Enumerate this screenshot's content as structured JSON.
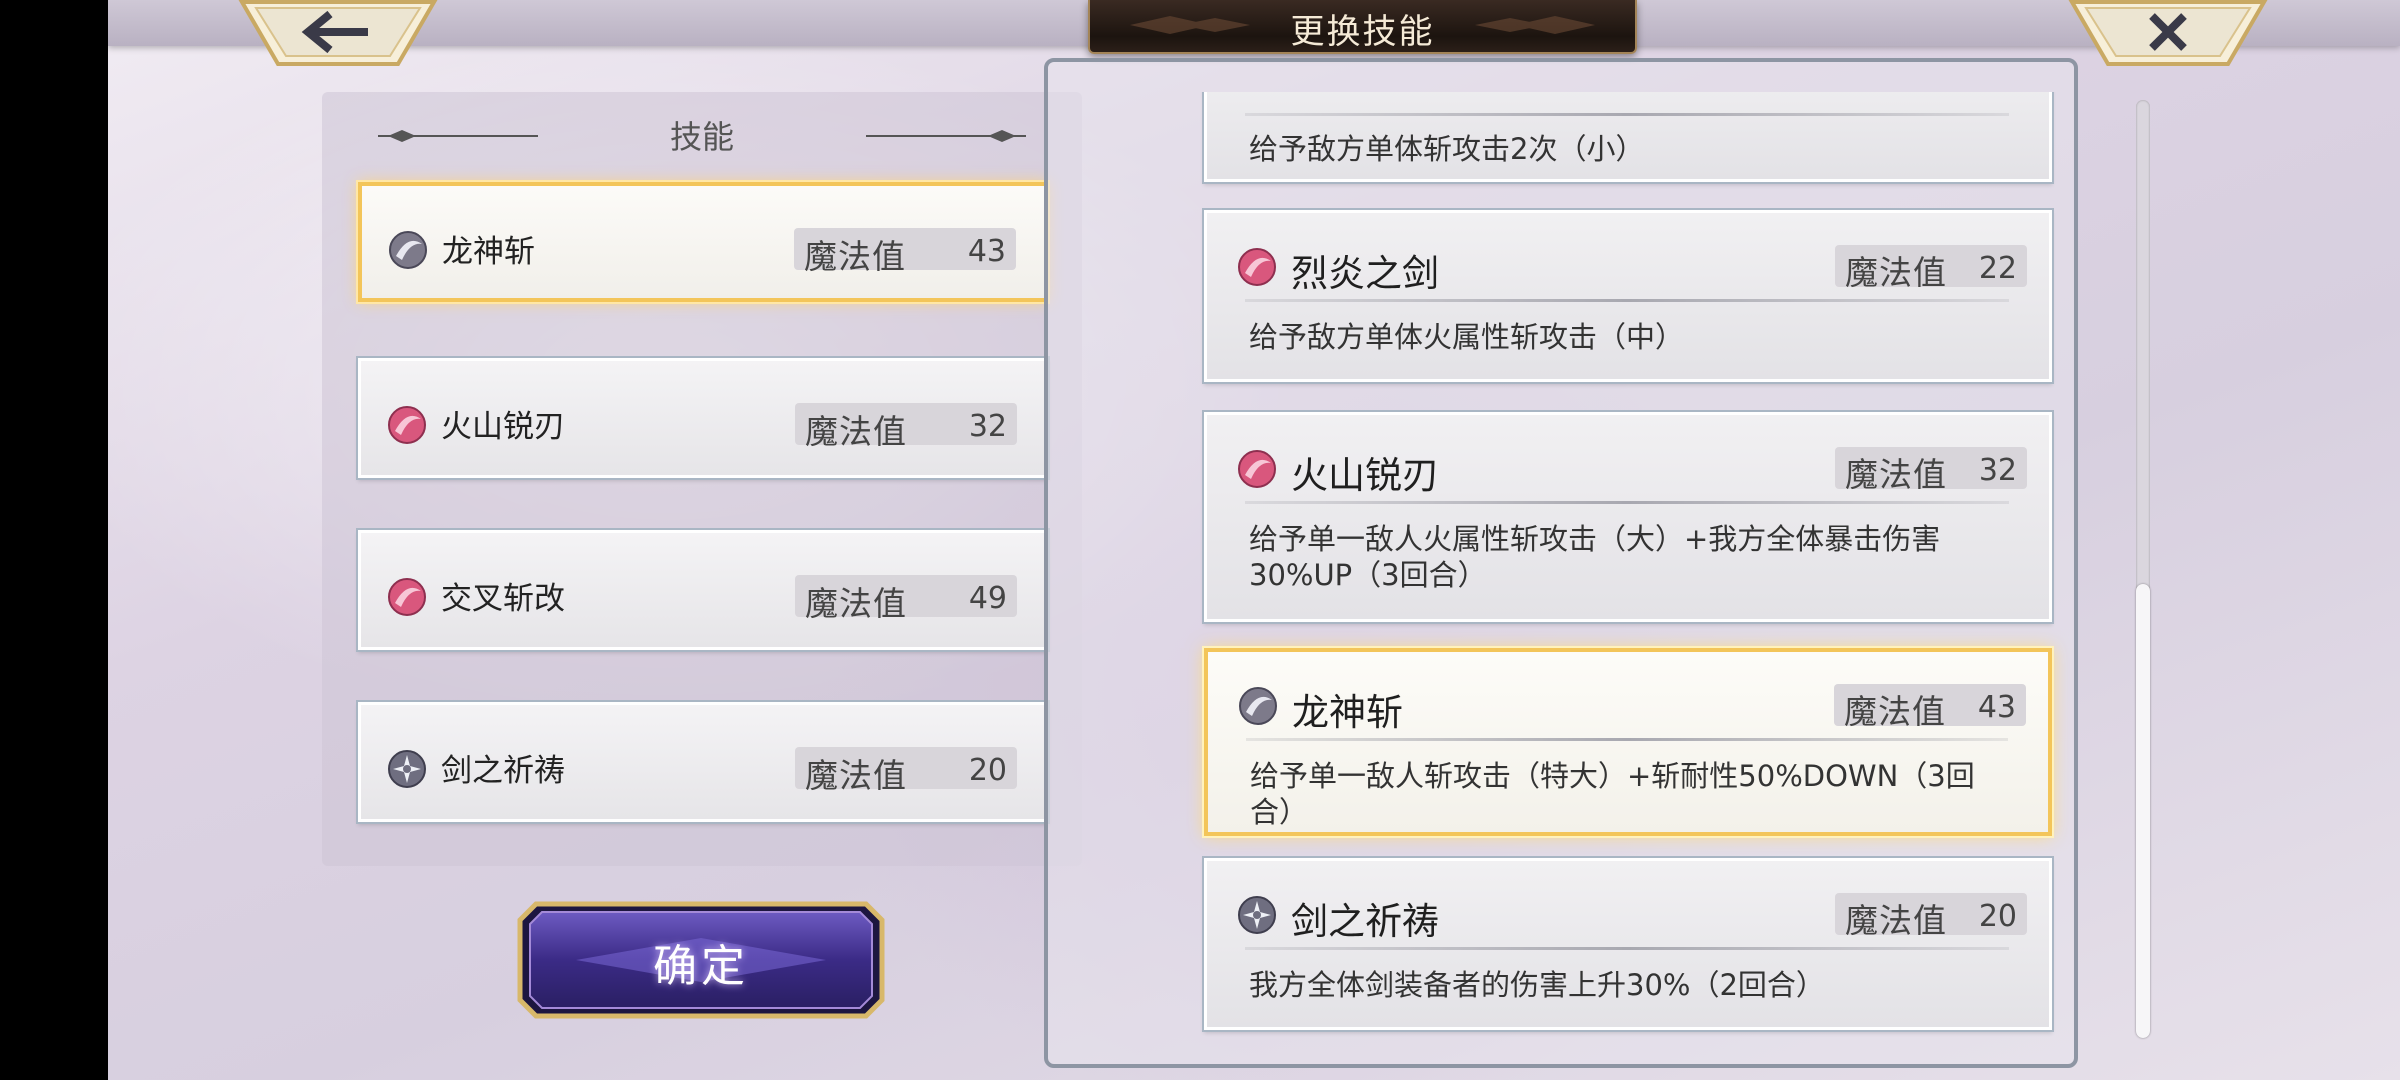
{
  "header": {
    "title": "更换技能",
    "back_icon": "back-arrow-icon",
    "close_icon": "close-icon"
  },
  "left_panel": {
    "heading": "技能",
    "slots": [
      {
        "name": "龙神斩",
        "mp_label": "魔法值",
        "mp": "43",
        "icon": "dragon-slash-icon",
        "selected": true
      },
      {
        "name": "火山锐刃",
        "mp_label": "魔法值",
        "mp": "32",
        "icon": "fire-slash-icon",
        "selected": false
      },
      {
        "name": "交叉斩改",
        "mp_label": "魔法值",
        "mp": "49",
        "icon": "fire-slash-icon",
        "selected": false
      },
      {
        "name": "剑之祈祷",
        "mp_label": "魔法值",
        "mp": "20",
        "icon": "buff-star-icon",
        "selected": false
      }
    ],
    "confirm_label": "确定"
  },
  "skill_list": [
    {
      "name": "",
      "mp_label": "",
      "mp": "",
      "desc": "给予敌方单体斩攻击2次（小）",
      "partial": true
    },
    {
      "name": "烈炎之剑",
      "mp_label": "魔法值",
      "mp": "22",
      "desc": "给予敌方单体火属性斩攻击（中）",
      "icon": "fire-slash-icon"
    },
    {
      "name": "火山锐刃",
      "mp_label": "魔法值",
      "mp": "32",
      "desc": "给予单一敌人火属性斩攻击（大）+我方全体暴击伤害30%UP（3回合）",
      "icon": "fire-slash-icon"
    },
    {
      "name": "龙神斩",
      "mp_label": "魔法值",
      "mp": "43",
      "desc": "给予单一敌人斩攻击（特大）+斩耐性50%DOWN（3回合）",
      "icon": "dragon-slash-icon",
      "selected": true
    },
    {
      "name": "剑之祈祷",
      "mp_label": "魔法值",
      "mp": "20",
      "desc": "我方全体剑装备者的伤害上升30%（2回合）",
      "icon": "buff-star-icon"
    }
  ],
  "colors": {
    "selected_border": "#f3c55a",
    "fire_icon": "#d9577d",
    "dragon_icon": "#7d7a8a",
    "confirm_button": "#4a3a8c"
  }
}
